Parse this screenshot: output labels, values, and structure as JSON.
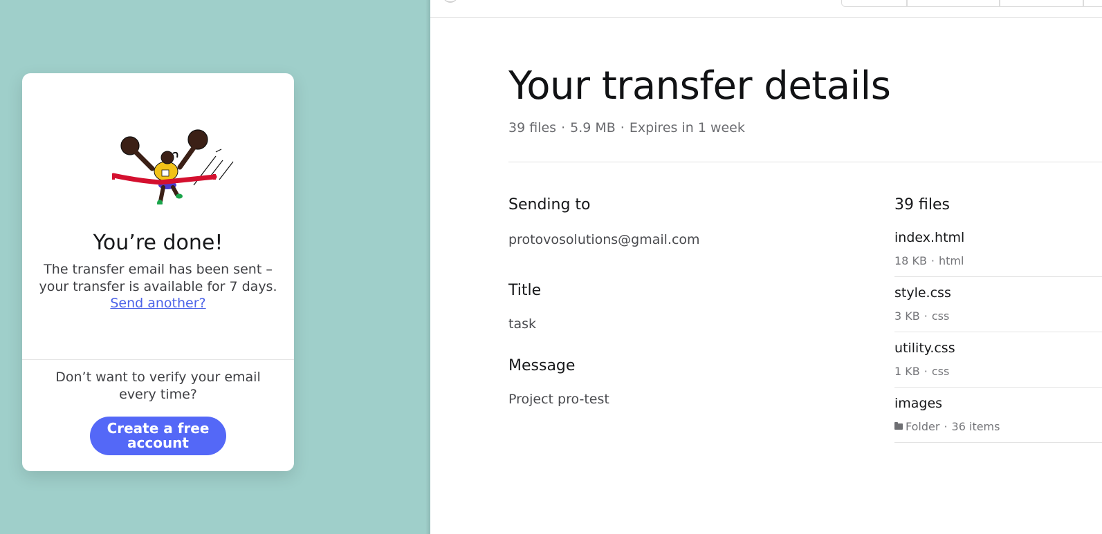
{
  "card": {
    "done_title": "You’re done!",
    "done_text": "The transfer email has been sent – your transfer is available for 7 days.",
    "send_another": "Send another?",
    "verify_text": "Don’t want to verify your email every time?",
    "create_account_button": "Create a free account",
    "illustration_icon": "finish-line-runner-illustration"
  },
  "details": {
    "title": "Your transfer details",
    "file_count": "39 files",
    "size": "5.9 MB",
    "expires": "Expires in 1 week",
    "separator": "·"
  },
  "sending_to": {
    "heading": "Sending to",
    "value": "protovosolutions@gmail.com"
  },
  "title_field": {
    "heading": "Title",
    "value": "task"
  },
  "message_field": {
    "heading": "Message",
    "value": "Project pro-test"
  },
  "files": {
    "heading": "39 files",
    "items": [
      {
        "name": "index.html",
        "size": "18 KB",
        "type": "html"
      },
      {
        "name": "style.css",
        "size": "3 KB",
        "type": "css"
      },
      {
        "name": "utility.css",
        "size": "1 KB",
        "type": "css"
      },
      {
        "name": "images",
        "size": "Folder",
        "type": "36 items",
        "icon": "folder-icon"
      }
    ]
  },
  "colors": {
    "left_background": "#9fcfca",
    "accent": "#5468f7",
    "link": "#4c63e8",
    "finish_ribbon": "#d4102f"
  }
}
